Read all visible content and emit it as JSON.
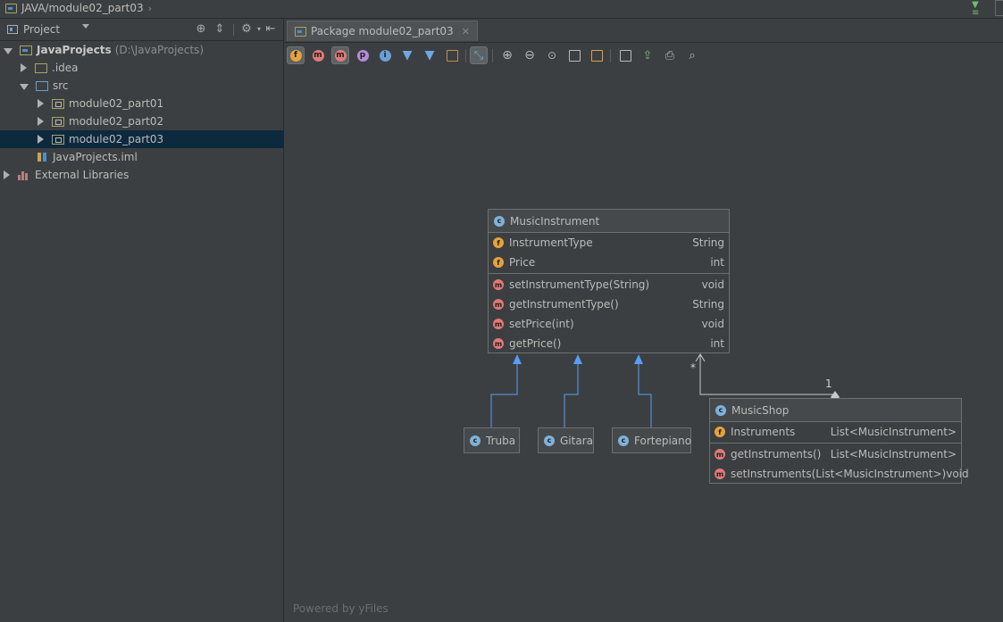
{
  "breadcrumb": {
    "path": "JAVA/module02_part03"
  },
  "project_panel": {
    "title": "Project",
    "tree": [
      {
        "label": "JavaProjects",
        "hint": "(D:\\JavaProjects)"
      },
      {
        "label": ".idea"
      },
      {
        "label": "src"
      },
      {
        "label": "module02_part01"
      },
      {
        "label": "module02_part02"
      },
      {
        "label": "module02_part03"
      },
      {
        "label": "JavaProjects.iml"
      },
      {
        "label": "External Libraries"
      }
    ]
  },
  "editor": {
    "tab_title": "Package module02_part03",
    "toolbar_letters": {
      "fields": "f",
      "fields_methods": "m",
      "methods": "m",
      "properties": "p",
      "inner": "i"
    },
    "powered_by": "Powered by yFiles"
  },
  "diagram": {
    "music_instrument": {
      "name": "MusicInstrument",
      "fields": [
        {
          "name": "InstrumentType",
          "type": "String"
        },
        {
          "name": "Price",
          "type": "int"
        }
      ],
      "methods": [
        {
          "name": "setInstrumentType(String)",
          "type": "void"
        },
        {
          "name": "getInstrumentType()",
          "type": "String"
        },
        {
          "name": "setPrice(int)",
          "type": "void"
        },
        {
          "name": "getPrice()",
          "type": "int"
        }
      ]
    },
    "subclasses": [
      "Truba",
      "Gitara",
      "Fortepiano"
    ],
    "music_shop": {
      "name": "MusicShop",
      "fields": [
        {
          "name": "Instruments",
          "type": "List<MusicInstrument>"
        }
      ],
      "methods": [
        {
          "name": "getInstruments()",
          "type": "List<MusicInstrument>"
        },
        {
          "name": "setInstruments(List<MusicInstrument>)",
          "type": "void"
        }
      ]
    },
    "association": {
      "many": "*",
      "one": "1"
    },
    "letters": {
      "class": "c",
      "field": "f",
      "method": "m"
    }
  },
  "colors": {
    "selection": "#0d293e",
    "inheritance_arrow": "#589df6",
    "field_icon": "#e6a23c",
    "method_icon": "#e07a78",
    "class_icon": "#7fb1d9"
  }
}
